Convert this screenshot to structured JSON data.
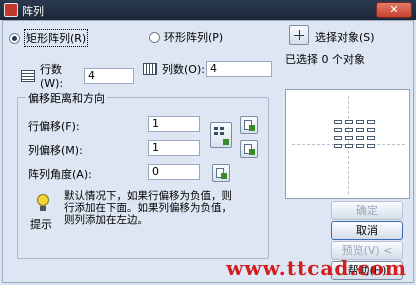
{
  "window": {
    "title": "阵列",
    "close_label": "✕"
  },
  "mode": {
    "rect_label": "矩形阵列(R)",
    "polar_label": "环形阵列(P)",
    "selected": "rect"
  },
  "rows": {
    "label": "行数(W):",
    "value": "4"
  },
  "cols": {
    "label": "列数(O):",
    "value": "4"
  },
  "offset_group": {
    "title": "偏移距离和方向",
    "row_offset_label": "行偏移(F):",
    "row_offset_value": "1",
    "col_offset_label": "列偏移(M):",
    "col_offset_value": "1",
    "angle_label": "阵列角度(A):",
    "angle_value": "0"
  },
  "hint": {
    "label": "提示",
    "text_line1": "默认情况下，如果行偏移为负值，则",
    "text_line2": "行添加在下面。如果列偏移为负值，",
    "text_line3": "则列添加在左边。"
  },
  "select": {
    "label": "选择对象(S)",
    "status": "已选择 0 个对象"
  },
  "buttons": {
    "ok": "确定",
    "cancel": "取消",
    "preview": "预览(V) <",
    "help": "帮助(H)"
  },
  "watermark": "www.ttcad.com",
  "colors": {
    "watermark": "#d21e1e",
    "titlebar": "#1f2b3d"
  }
}
